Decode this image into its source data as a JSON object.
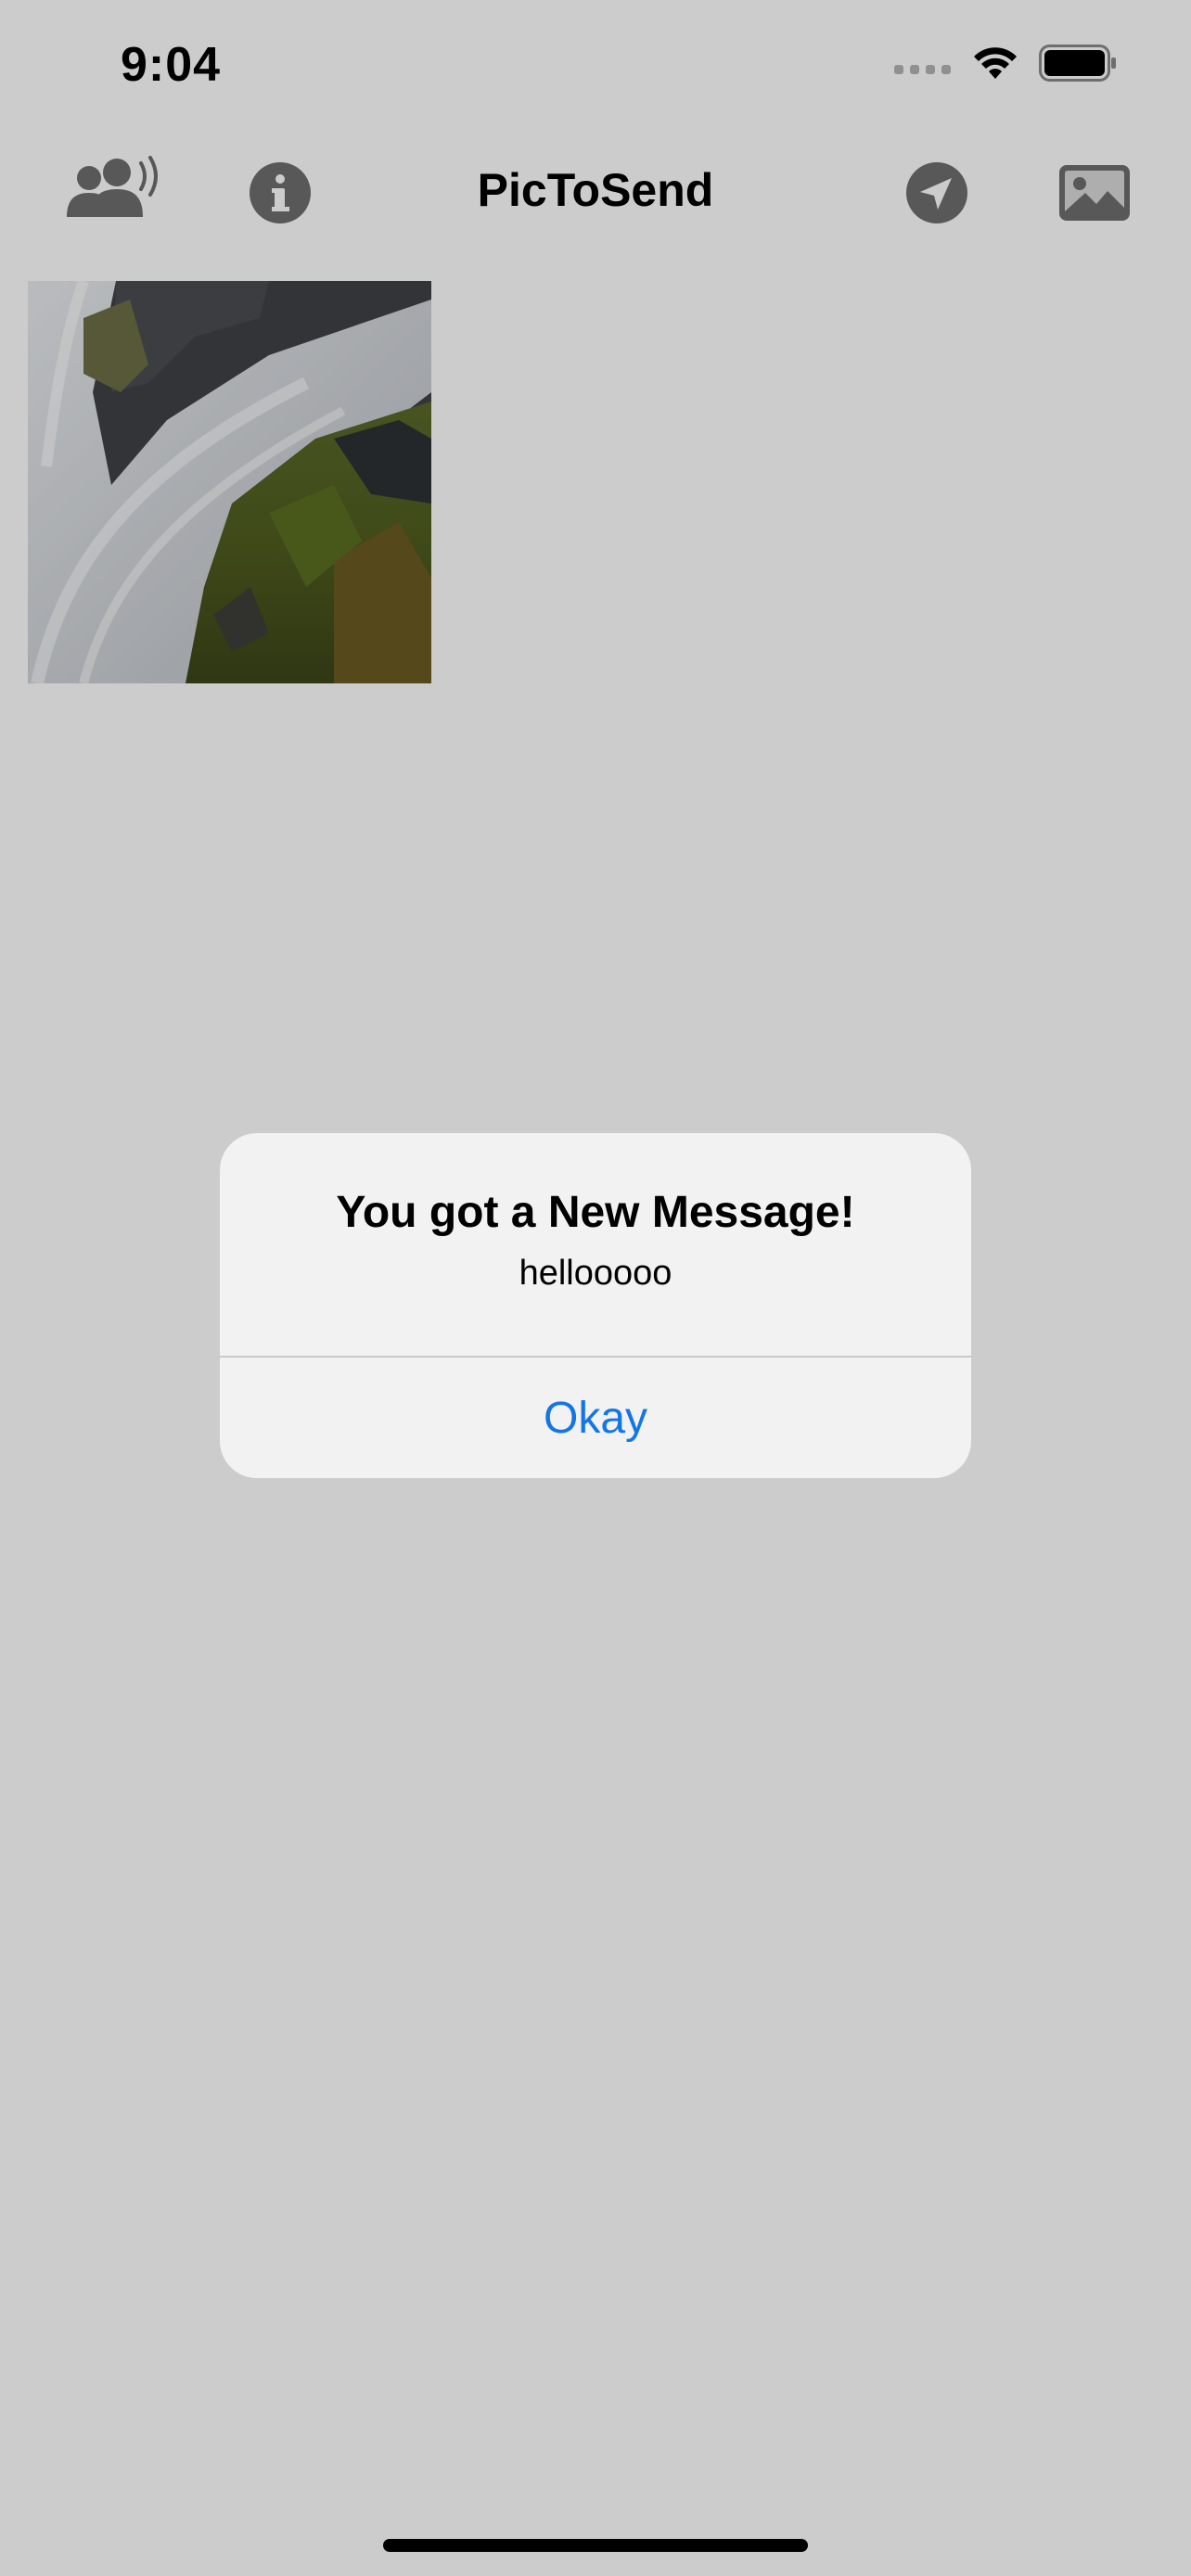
{
  "status_bar": {
    "time": "9:04",
    "icons": [
      "cellular-signal-icon",
      "wifi-icon",
      "battery-icon"
    ]
  },
  "nav": {
    "title": "PicToSend",
    "left_buttons": [
      "peers-broadcast-icon",
      "info-icon"
    ],
    "right_buttons": [
      "send-icon",
      "photo-library-icon"
    ]
  },
  "photos": [
    {
      "description_icon": "waterfall-photo"
    }
  ],
  "alert": {
    "title": "You got a New Message!",
    "message": "hellooooo",
    "button_label": "Okay"
  },
  "colors": {
    "accent": "#1476e6",
    "icon_gray": "#6f6f6f",
    "alert_bg": "#f1f2f1",
    "dim_overlay": "rgba(0,0,0,0.2)"
  }
}
